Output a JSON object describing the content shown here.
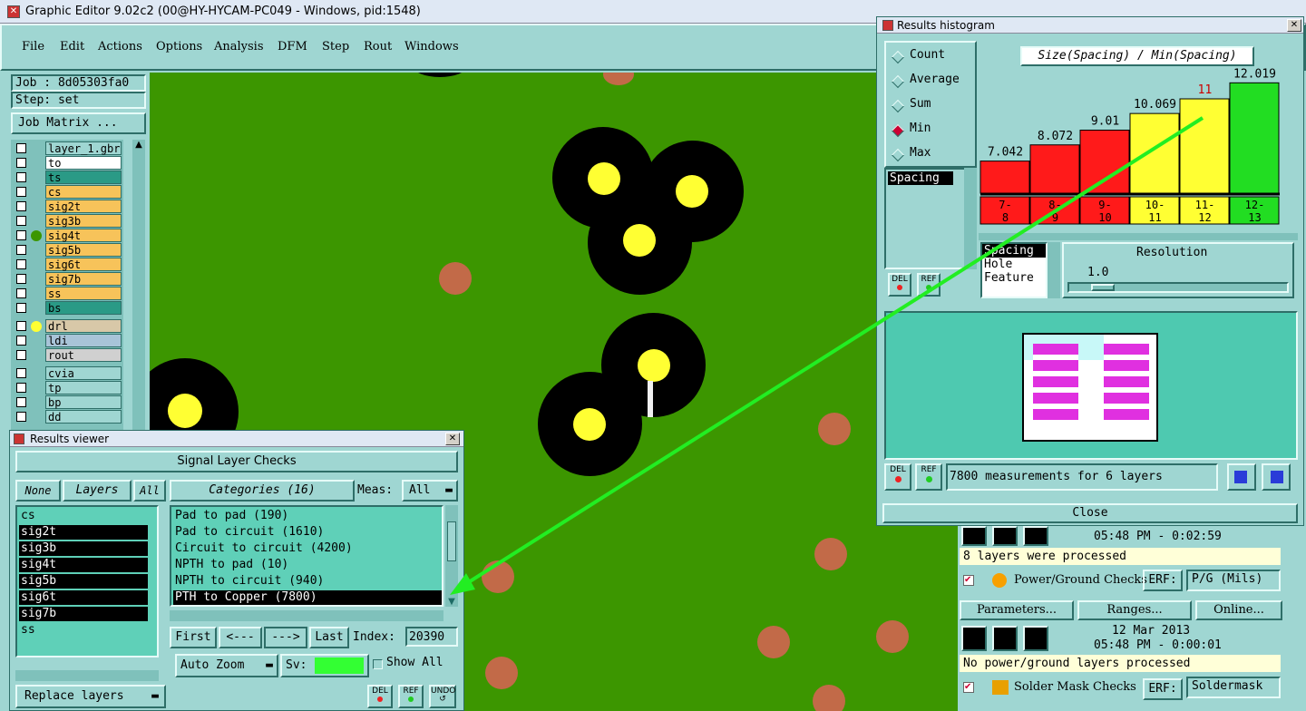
{
  "main_window": {
    "title": "Graphic Editor 9.02c2 (00@HY-HYCAM-PC049 - Windows, pid:1548)",
    "menu": [
      "File",
      "Edit",
      "Actions",
      "Options",
      "Analysis",
      "DFM",
      "Step",
      "Rout",
      "Windows"
    ]
  },
  "left_panel": {
    "job": "Job : 8d05303fa0",
    "step": "Step: set",
    "job_matrix": "Job Matrix ...",
    "layers": [
      {
        "name": "layer_1.gbr",
        "color": "#9fd6d2"
      },
      {
        "name": "to",
        "color": "#ffffff"
      },
      {
        "name": "ts",
        "color": "#2a9a86"
      },
      {
        "name": "cs",
        "color": "#f7c35a"
      },
      {
        "name": "sig2t",
        "color": "#f7c35a"
      },
      {
        "name": "sig3b",
        "color": "#f7c35a"
      },
      {
        "name": "sig4t",
        "color": "#f7c35a"
      },
      {
        "name": "sig5b",
        "color": "#f7c35a"
      },
      {
        "name": "sig6t",
        "color": "#f7c35a"
      },
      {
        "name": "sig7b",
        "color": "#f7c35a"
      },
      {
        "name": "ss",
        "color": "#f7c35a"
      },
      {
        "name": "bs",
        "color": "#2a9a86"
      },
      {
        "name": "drl",
        "color": "#d8c8a8"
      },
      {
        "name": "ldi",
        "color": "#a8c4d8"
      },
      {
        "name": "rout",
        "color": "#d0d0d0"
      },
      {
        "name": "cvia",
        "color": "#9fd6d2"
      },
      {
        "name": "tp",
        "color": "#9fd6d2"
      },
      {
        "name": "bp",
        "color": "#9fd6d2"
      },
      {
        "name": "dd",
        "color": "#9fd6d2"
      }
    ]
  },
  "results_viewer": {
    "title": "Results viewer",
    "header": "Signal Layer Checks",
    "none_btn": "None",
    "layers_btn": "Layers",
    "all_btn": "All",
    "layer_list": [
      "cs",
      "sig2t",
      "sig3b",
      "sig4t",
      "sig5b",
      "sig6t",
      "sig7b",
      "ss"
    ],
    "categories_btn": "Categories (16)",
    "meas_label": "Meas:",
    "meas_value": "All",
    "categories": [
      "Pad to pad (190)",
      "Pad to circuit (1610)",
      "Circuit to circuit (4200)",
      "NPTH to pad (10)",
      "NPTH to circuit (940)",
      "PTH to Copper (7800)"
    ],
    "first": "First",
    "prev": "<---",
    "next": "--->",
    "last": "Last",
    "index_label": "Index:",
    "index_value": "20390",
    "auto_zoom": "Auto Zoom",
    "sv_label": "Sv:",
    "show_all": "Show All",
    "replace_layers": "Replace layers",
    "del": "DEL",
    "ref": "REF",
    "undo": "UNDO"
  },
  "histogram": {
    "title": "Results histogram",
    "modes": [
      "Count",
      "Average",
      "Sum",
      "Min",
      "Max"
    ],
    "selected_mode": "Min",
    "chart_title": "Size(Spacing) / Min(Spacing)",
    "list_item": "Spacing",
    "types": [
      "Spacing",
      "Hole",
      "Feature"
    ],
    "resolution_label": "Resolution",
    "resolution_value": "1.0",
    "measurements": "7800 measurements for 6 layers",
    "close": "Close",
    "del": "DEL",
    "ref": "REF"
  },
  "chart_data": {
    "type": "bar",
    "title": "Size(Spacing) / Min(Spacing)",
    "categories": [
      "7-\n8",
      "8-\n9",
      "9-\n10",
      "10-\n11",
      "11-\n12",
      "12-\n13"
    ],
    "values": [
      7.042,
      8.072,
      9.01,
      10.069,
      11,
      12.019
    ],
    "value_labels": [
      "7.042",
      "8.072",
      "9.01",
      "10.069",
      "11",
      "12.019"
    ],
    "colors": [
      "#ff1a1a",
      "#ff1a1a",
      "#ff1a1a",
      "#ffff33",
      "#ffff33",
      "#22dd22"
    ],
    "highlight_label_color": "#cc0000",
    "ylim": [
      0,
      12.5
    ]
  },
  "checks_panel": {
    "time1": "05:48 PM - 0:02:59",
    "msg1": "8 layers were processed",
    "power_label": "Power/Ground Checks",
    "erf1": "ERF:",
    "erf1_value": "P/G (Mils)",
    "parameters": "Parameters...",
    "ranges": "Ranges...",
    "online": "Online...",
    "date2": "12 Mar 2013",
    "time2": "05:48 PM - 0:00:01",
    "msg2": "No power/ground layers processed",
    "solder_label": "Solder Mask Checks",
    "erf2": "ERF:",
    "erf2_value": "Soldermask"
  }
}
